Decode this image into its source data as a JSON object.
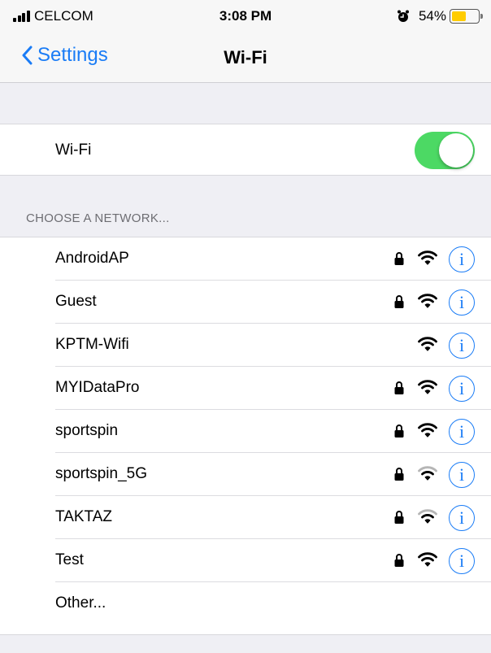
{
  "status_bar": {
    "carrier": "CELCOM",
    "time": "3:08 PM",
    "battery_percent": "54%",
    "battery_level": 0.54,
    "battery_color": "#ffcc00"
  },
  "nav": {
    "back_label": "Settings",
    "title": "Wi-Fi",
    "accent": "#1a7cf6"
  },
  "wifi_toggle": {
    "label": "Wi-Fi",
    "on": true,
    "on_color": "#4cd964"
  },
  "section_header": "CHOOSE A NETWORK...",
  "networks": [
    {
      "name": "AndroidAP",
      "locked": true,
      "signal": "full"
    },
    {
      "name": "Guest",
      "locked": true,
      "signal": "full"
    },
    {
      "name": "KPTM-Wifi",
      "locked": false,
      "signal": "full"
    },
    {
      "name": "MYIDataPro",
      "locked": true,
      "signal": "full"
    },
    {
      "name": "sportspin",
      "locked": true,
      "signal": "full"
    },
    {
      "name": "sportspin_5G",
      "locked": true,
      "signal": "weak"
    },
    {
      "name": "TAKTAZ",
      "locked": true,
      "signal": "weak"
    },
    {
      "name": "Test",
      "locked": true,
      "signal": "full"
    }
  ],
  "other_label": "Other...",
  "icons": {
    "lock": "lock-icon",
    "wifi": "wifi-icon",
    "info": "info-icon",
    "back": "chevron-left-icon",
    "alarm": "alarm-clock-icon"
  },
  "info_glyph": "i"
}
